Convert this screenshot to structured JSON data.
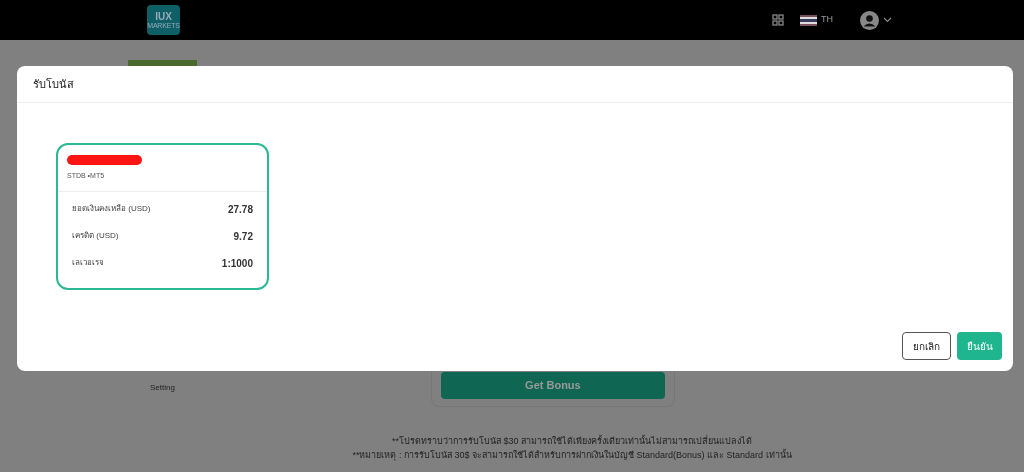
{
  "header": {
    "logo": "IUX",
    "logo_sub": "MARKETS",
    "language": "TH"
  },
  "page": {
    "setting_label": "Setting",
    "get_bonus_button": "Get Bonus",
    "notes": [
      "**โปรดทราบว่าการรับโบนัส $30 สามารถใช้ได้เพียงครั้งเดียวเท่านั้นไม่สามารถเปลี่ยนแปลงได้",
      "**หมายเหตุ : การรับโบนัส 30$ จะสามารถใช้ได้สำหรับการฝากเงินในบัญชี Standard(Bonus) และ Standard เท่านั้น"
    ]
  },
  "dialog": {
    "title": "รับโบนัส",
    "account": {
      "selected": true,
      "type": "STDB •MT5",
      "rows": [
        {
          "label": "ยอดเงินคงเหลือ (USD)",
          "value": "27.78"
        },
        {
          "label": "เครดิต (USD)",
          "value": "9.72"
        },
        {
          "label": "เลเวอเรจ",
          "value": "1:1000"
        }
      ]
    },
    "buttons": [
      {
        "label": "ยกเลิก",
        "kind": "secondary"
      },
      {
        "label": "ยืนยัน",
        "kind": "primary"
      }
    ]
  }
}
